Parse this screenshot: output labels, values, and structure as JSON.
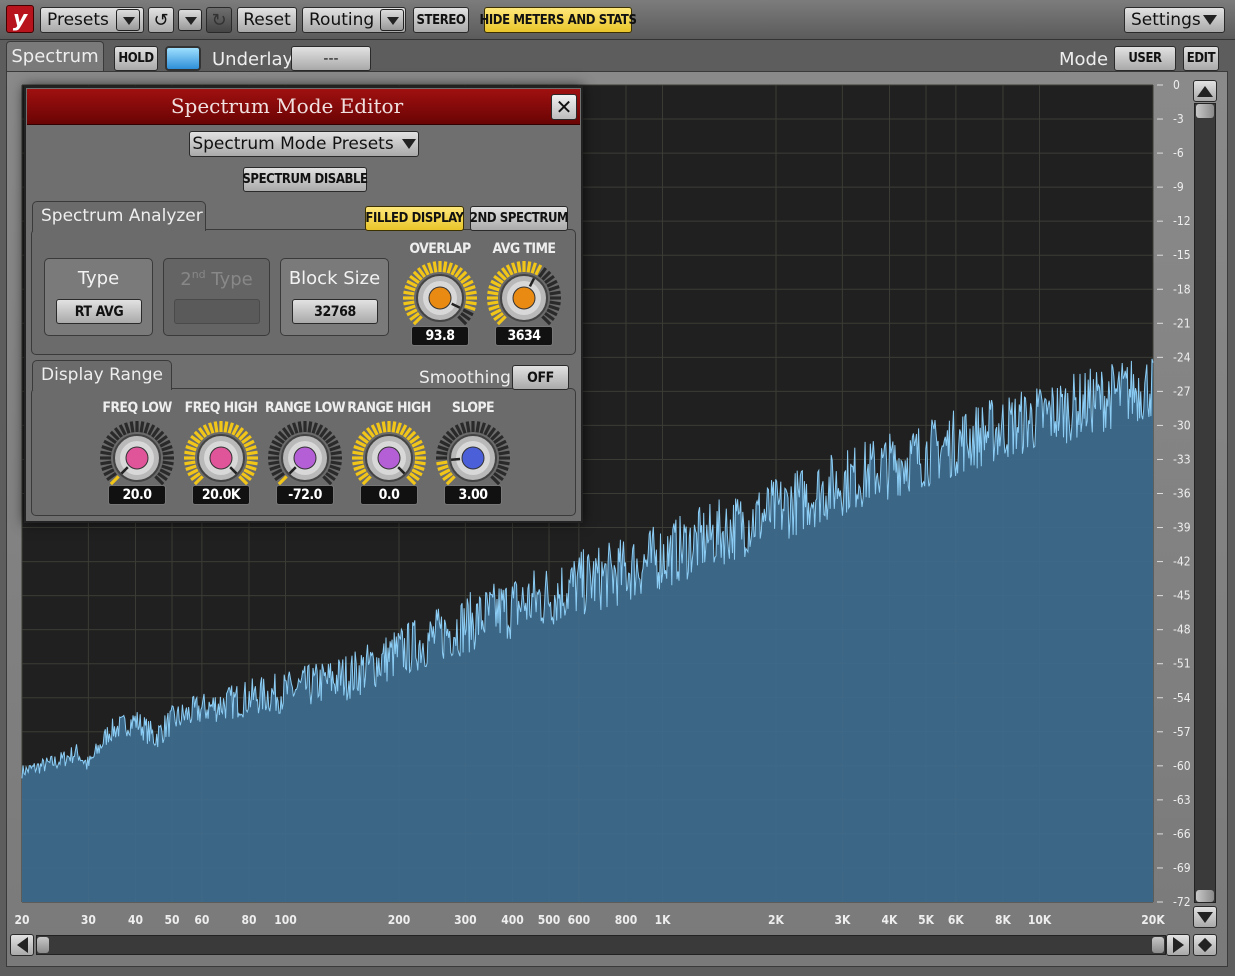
{
  "toolbar": {
    "logo": "y",
    "presets": "Presets",
    "reset": "Reset",
    "routing": "Routing",
    "stereo": "STEREO",
    "hide_meters": "HIDE METERS AND STATS",
    "settings": "Settings"
  },
  "subbar": {
    "tab": "Spectrum",
    "hold": "HOLD",
    "underlay_label": "Underlay",
    "underlay_value": "---",
    "mode_label": "Mode",
    "mode_value": "USER",
    "edit": "EDIT"
  },
  "editor": {
    "title": "Spectrum Mode Editor",
    "presets": "Spectrum Mode Presets",
    "disable": "SPECTRUM DISABLE",
    "analyzer": {
      "header": "Spectrum Analyzer",
      "filled": "FILLED DISPLAY",
      "second": "2ND SPECTRUM",
      "type_label": "Type",
      "type_value": "RT AVG",
      "type2_label": "2",
      "type2_sup": "nd",
      "type2_rest": " Type",
      "block_label": "Block Size",
      "block_value": "32768",
      "overlap_label": "OVERLAP",
      "overlap_value": "93.8",
      "avg_label": "AVG TIME",
      "avg_value": "3634"
    },
    "range": {
      "header": "Display Range",
      "smoothing_label": "Smoothing",
      "smoothing_value": "OFF",
      "knobs": [
        {
          "label": "FREQ LOW",
          "value": "20.0",
          "color": "#e0559a"
        },
        {
          "label": "FREQ HIGH",
          "value": "20.0K",
          "color": "#e0559a"
        },
        {
          "label": "RANGE LOW",
          "value": "-72.0",
          "color": "#b45fd6"
        },
        {
          "label": "RANGE HIGH",
          "value": "0.0",
          "color": "#b45fd6"
        },
        {
          "label": "SLOPE",
          "value": "3.00",
          "color": "#4a5fd8"
        }
      ]
    }
  },
  "chart_data": {
    "type": "area",
    "xscale": "log",
    "xlim": [
      20,
      20000
    ],
    "ylim": [
      -72,
      0
    ],
    "y_ticks": [
      "0",
      "-3",
      "-6",
      "-9",
      "-12",
      "-15",
      "-18",
      "-21",
      "-24",
      "-27",
      "-30",
      "-33",
      "-36",
      "-39",
      "-42",
      "-45",
      "-48",
      "-51",
      "-54",
      "-57",
      "-60",
      "-63",
      "-66",
      "-69",
      "-72"
    ],
    "x_ticks": [
      {
        "v": 20,
        "l": "20"
      },
      {
        "v": 30,
        "l": "30"
      },
      {
        "v": 40,
        "l": "40"
      },
      {
        "v": 50,
        "l": "50"
      },
      {
        "v": 60,
        "l": "60"
      },
      {
        "v": 80,
        "l": "80"
      },
      {
        "v": 100,
        "l": "100"
      },
      {
        "v": 200,
        "l": "200"
      },
      {
        "v": 300,
        "l": "300"
      },
      {
        "v": 400,
        "l": "400"
      },
      {
        "v": 500,
        "l": "500"
      },
      {
        "v": 600,
        "l": "600"
      },
      {
        "v": 800,
        "l": "800"
      },
      {
        "v": 1000,
        "l": "1K"
      },
      {
        "v": 2000,
        "l": "2K"
      },
      {
        "v": 3000,
        "l": "3K"
      },
      {
        "v": 4000,
        "l": "4K"
      },
      {
        "v": 5000,
        "l": "5K"
      },
      {
        "v": 6000,
        "l": "6K"
      },
      {
        "v": 8000,
        "l": "8K"
      },
      {
        "v": 10000,
        "l": "10K"
      },
      {
        "v": 20000,
        "l": "20K"
      }
    ],
    "points": [
      [
        20,
        -60.5
      ],
      [
        25,
        -59.6
      ],
      [
        28,
        -58.8
      ],
      [
        30,
        -60
      ],
      [
        34,
        -57
      ],
      [
        40,
        -56
      ],
      [
        45,
        -57.5
      ],
      [
        50,
        -56
      ],
      [
        60,
        -55
      ],
      [
        80,
        -54
      ],
      [
        100,
        -53.5
      ],
      [
        150,
        -52
      ],
      [
        200,
        -50
      ],
      [
        300,
        -47.5
      ],
      [
        400,
        -46
      ],
      [
        500,
        -45
      ],
      [
        600,
        -44
      ],
      [
        800,
        -42.8
      ],
      [
        1000,
        -41.5
      ],
      [
        2000,
        -37.5
      ],
      [
        3000,
        -35
      ],
      [
        4000,
        -33.5
      ],
      [
        5000,
        -32.5
      ],
      [
        6000,
        -31.5
      ],
      [
        8000,
        -30.2
      ],
      [
        10000,
        -29.3
      ],
      [
        15000,
        -27.5
      ],
      [
        20000,
        -26.5
      ]
    ],
    "fill_color": "#3f6d8e",
    "line_color": "#8ccdf5"
  }
}
